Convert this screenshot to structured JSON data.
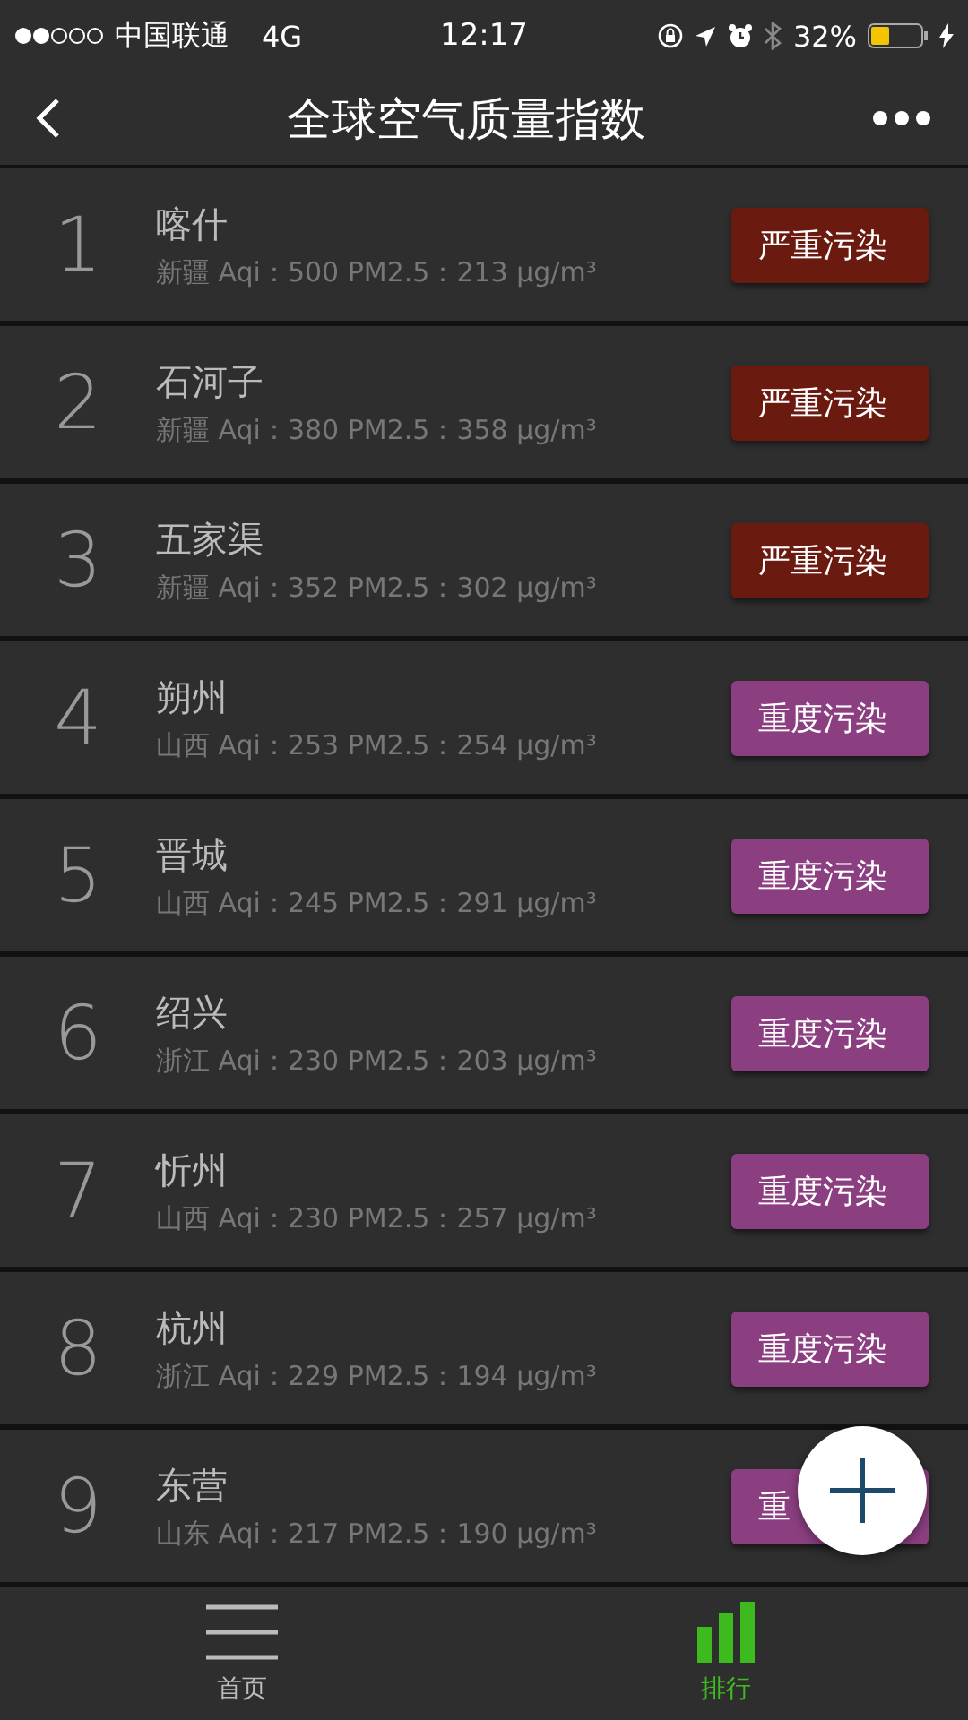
{
  "status_bar": {
    "carrier": "中国联通",
    "network": "4G",
    "time": "12:17",
    "battery": "32%"
  },
  "nav": {
    "title": "全球空气质量指数"
  },
  "rows": [
    {
      "rank": "1",
      "city": "喀什",
      "detail": "新疆 Aqi：500 PM2.5：213 μg/m³",
      "badge": "严重污染",
      "color": "#6b1a10"
    },
    {
      "rank": "2",
      "city": "石河子",
      "detail": "新疆 Aqi：380 PM2.5：358 μg/m³",
      "badge": "严重污染",
      "color": "#6b1a10"
    },
    {
      "rank": "3",
      "city": "五家渠",
      "detail": "新疆 Aqi：352 PM2.5：302 μg/m³",
      "badge": "严重污染",
      "color": "#6b1a10"
    },
    {
      "rank": "4",
      "city": "朔州",
      "detail": "山西 Aqi：253 PM2.5：254 μg/m³",
      "badge": "重度污染",
      "color": "#8b3f80"
    },
    {
      "rank": "5",
      "city": "晋城",
      "detail": "山西 Aqi：245 PM2.5：291 μg/m³",
      "badge": "重度污染",
      "color": "#8b3f80"
    },
    {
      "rank": "6",
      "city": "绍兴",
      "detail": "浙江 Aqi：230 PM2.5：203 μg/m³",
      "badge": "重度污染",
      "color": "#8b3f80"
    },
    {
      "rank": "7",
      "city": "忻州",
      "detail": "山西 Aqi：230 PM2.5：257 μg/m³",
      "badge": "重度污染",
      "color": "#8b3f80"
    },
    {
      "rank": "8",
      "city": "杭州",
      "detail": "浙江 Aqi：229 PM2.5：194 μg/m³",
      "badge": "重度污染",
      "color": "#8b3f80"
    },
    {
      "rank": "9",
      "city": "东营",
      "detail": "山东 Aqi：217 PM2.5：190 μg/m³",
      "badge": "重",
      "color": "#8b3f80"
    }
  ],
  "tabs": [
    {
      "label": "首页",
      "selected": false,
      "kind": "menu"
    },
    {
      "label": "排行",
      "selected": true,
      "kind": "chart"
    }
  ]
}
